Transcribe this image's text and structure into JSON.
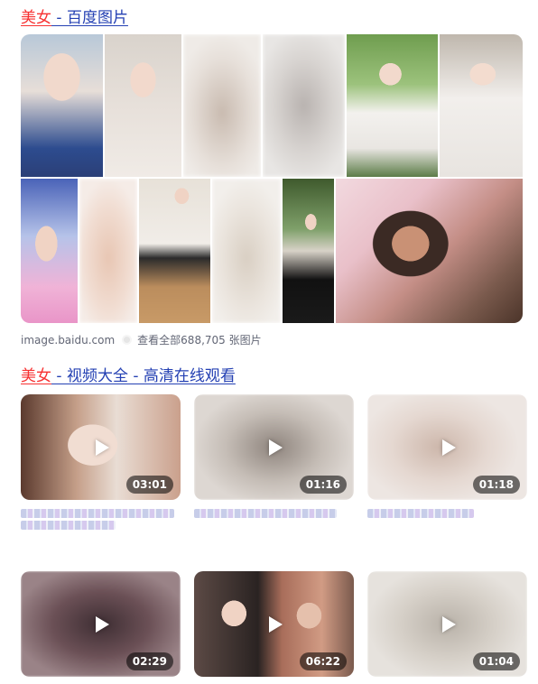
{
  "images_section": {
    "title_keyword": "美女",
    "title_rest": " - 百度图片",
    "source_site": "image.baidu.com",
    "view_all": "查看全部688,705 张图片"
  },
  "videos_section": {
    "title_keyword": "美女",
    "title_rest": " - 视频大全 - 高清在线观看",
    "videos": [
      {
        "duration": "03:01"
      },
      {
        "duration": "01:16"
      },
      {
        "duration": "01:18"
      },
      {
        "duration": "02:29"
      },
      {
        "duration": "06:22"
      },
      {
        "duration": "01:04"
      }
    ]
  },
  "colors": {
    "link": "#2440b3",
    "keyword": "#f73131",
    "muted": "#626675"
  },
  "icons": {
    "play": "play-icon",
    "source_dot": "source-favicon-icon"
  }
}
